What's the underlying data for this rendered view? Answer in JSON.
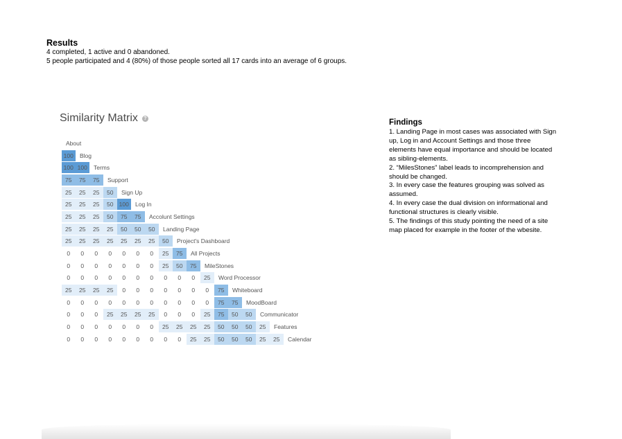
{
  "results": {
    "heading": "Results",
    "line1": "4 completed, 1 active and 0 abandoned.",
    "line2": "5 people participated and 4 (80%) of those people sorted all 17 cards into an average of 6 groups."
  },
  "matrix": {
    "title": "Similarity Matrix",
    "help_icon_glyph": "?",
    "colors": {
      "100": "#5b9bd5",
      "75": "#8fbde6",
      "50": "#bcd8f1",
      "25": "#e2eef9",
      "0": "#ffffff"
    },
    "rows": [
      {
        "label": "About",
        "values": []
      },
      {
        "label": "Blog",
        "values": [
          100
        ]
      },
      {
        "label": "Terms",
        "values": [
          100,
          100
        ]
      },
      {
        "label": "Support",
        "values": [
          75,
          75,
          75
        ]
      },
      {
        "label": "Sign Up",
        "values": [
          25,
          25,
          25,
          50
        ]
      },
      {
        "label": "Log In",
        "values": [
          25,
          25,
          25,
          50,
          100
        ]
      },
      {
        "label": "Accolunt Settings",
        "values": [
          25,
          25,
          25,
          50,
          75,
          75
        ]
      },
      {
        "label": "Landing Page",
        "values": [
          25,
          25,
          25,
          25,
          50,
          50,
          50
        ]
      },
      {
        "label": "Project's Dashboard",
        "values": [
          25,
          25,
          25,
          25,
          25,
          25,
          25,
          50
        ]
      },
      {
        "label": "All Projects",
        "values": [
          0,
          0,
          0,
          0,
          0,
          0,
          0,
          25,
          75
        ]
      },
      {
        "label": "MileStones",
        "values": [
          0,
          0,
          0,
          0,
          0,
          0,
          0,
          25,
          50,
          75
        ]
      },
      {
        "label": "Word Processor",
        "values": [
          0,
          0,
          0,
          0,
          0,
          0,
          0,
          0,
          0,
          0,
          25
        ]
      },
      {
        "label": "Whiteboard",
        "values": [
          25,
          25,
          25,
          25,
          0,
          0,
          0,
          0,
          0,
          0,
          0,
          75
        ]
      },
      {
        "label": "MoodBoard",
        "values": [
          0,
          0,
          0,
          0,
          0,
          0,
          0,
          0,
          0,
          0,
          0,
          75,
          75
        ]
      },
      {
        "label": "Communicator",
        "values": [
          0,
          0,
          0,
          25,
          25,
          25,
          25,
          0,
          0,
          0,
          25,
          75,
          50,
          50
        ]
      },
      {
        "label": "Features",
        "values": [
          0,
          0,
          0,
          0,
          0,
          0,
          0,
          25,
          25,
          25,
          25,
          50,
          50,
          50,
          25
        ]
      },
      {
        "label": "Calendar",
        "values": [
          0,
          0,
          0,
          0,
          0,
          0,
          0,
          0,
          0,
          25,
          25,
          50,
          50,
          50,
          25,
          25
        ]
      }
    ]
  },
  "findings": {
    "heading": "Findings",
    "items": [
      "1. Landing Page in most cases was associated with Sign up, Log in and Account Settings and those three elements have equal importance and should be located as sibling-elements.",
      "2. “MilesStones” label leads to incomprehension and should be changed.",
      "3. In every case the features grouping was solved as assumed.",
      "4. In every case the dual division on informational and functional structures is clearly visible.",
      "5. The findings of this study pointing the need of a site map placed for example in the footer of the wbesite."
    ]
  }
}
